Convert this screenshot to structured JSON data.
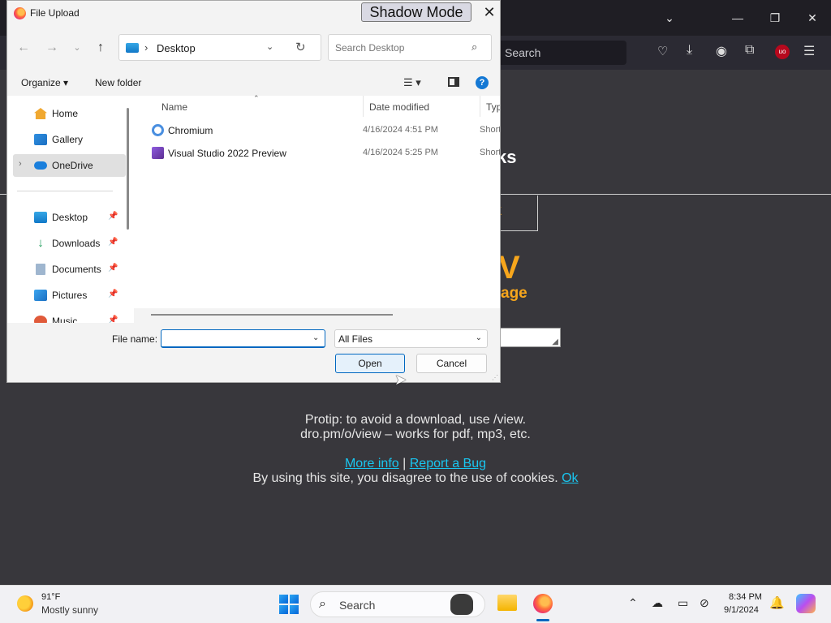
{
  "dialog": {
    "title": "File Upload",
    "shadow_mode_label": "Shadow Mode",
    "address": {
      "current": "Desktop"
    },
    "search_placeholder": "Search Desktop",
    "toolbar": {
      "organize": "Organize ▾",
      "new_folder": "New folder"
    },
    "nav_items": [
      {
        "label": "Home",
        "icon": "home-icon"
      },
      {
        "label": "Gallery",
        "icon": "gallery-icon"
      },
      {
        "label": "OneDrive",
        "icon": "onedrive-icon",
        "selected": true
      },
      {
        "label": "Desktop",
        "icon": "desktop-icon",
        "pinned": true
      },
      {
        "label": "Downloads",
        "icon": "downloads-icon",
        "pinned": true
      },
      {
        "label": "Documents",
        "icon": "documents-icon",
        "pinned": true
      },
      {
        "label": "Pictures",
        "icon": "pictures-icon",
        "pinned": true
      },
      {
        "label": "Music",
        "icon": "music-icon",
        "pinned": true
      }
    ],
    "columns": {
      "name": "Name",
      "date_modified": "Date modified",
      "type": "Type"
    },
    "files": [
      {
        "name": "Chromium",
        "date": "4/16/2024 4:51 PM",
        "type": "Short"
      },
      {
        "name": "Visual Studio 2022 Preview",
        "date": "4/16/2024 5:25 PM",
        "type": "Short"
      }
    ],
    "file_name_label": "File name:",
    "file_name_value": "",
    "file_type": "All Files",
    "open_label": "Open",
    "cancel_label": "Cancel"
  },
  "browser": {
    "search_placeholder": "Search",
    "accent": "#f7a61c",
    "link_color": "#19c6f0"
  },
  "page": {
    "heading_fragment": "ks",
    "link_button_fragment": "nk",
    "big_letter": "V",
    "subheading_fragment": "age",
    "protip_line1": "Protip: to avoid a download, use /view.",
    "protip_line2": "dro.pm/o/view – works for pdf, mp3, etc.",
    "more_info": "More info",
    "separator": "|",
    "report_bug": "Report a Bug",
    "cookie_text": "By using this site, you disagree to the use of cookies.",
    "cookie_ok": "Ok"
  },
  "taskbar": {
    "weather_temp": "91°F",
    "weather_desc": "Mostly sunny",
    "search_placeholder": "Search",
    "time": "8:34 PM",
    "date": "9/1/2024"
  }
}
